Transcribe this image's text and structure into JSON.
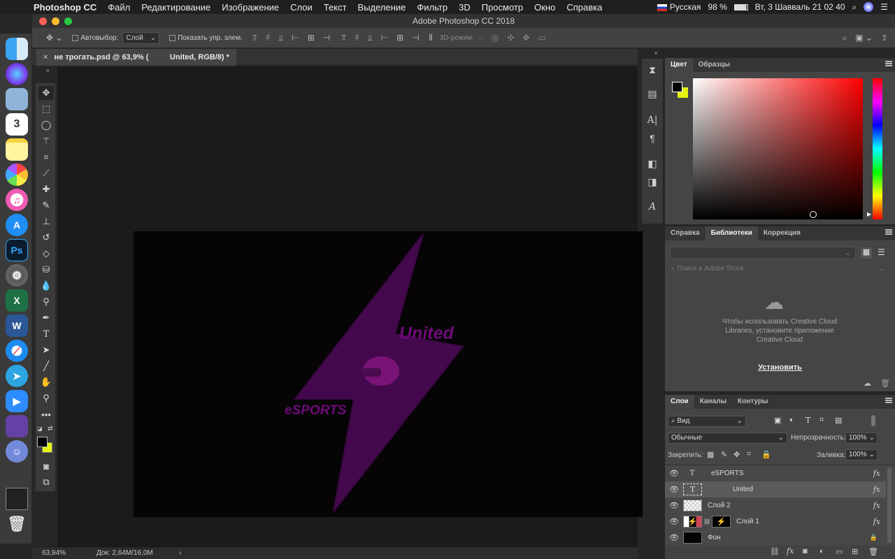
{
  "menubar": {
    "app_name": "Photoshop CC",
    "items": [
      "Файл",
      "Редактирование",
      "Изображение",
      "Слои",
      "Текст",
      "Выделение",
      "Фильтр",
      "3D",
      "Просмотр",
      "Окно",
      "Справка"
    ],
    "input_source": "Русская",
    "battery": "98 %",
    "clock": "Вт, 3 Шавваль  21 02 40"
  },
  "window": {
    "title": "Adobe Photoshop CC 2018"
  },
  "options_bar": {
    "autoselect_label": "Автовыбор:",
    "autoselect_value": "Слой",
    "show_transform_label": "Показать упр. элем.",
    "mode_3d_label": "3D-режим:"
  },
  "document": {
    "tab_title": "не трогать.psd @ 63,9% (          United, RGB/8) *"
  },
  "status_bar": {
    "zoom": "63,94%",
    "doc_size": "Док: 2,64M/16,0M"
  },
  "artwork": {
    "united_text": "United",
    "esports_text": "eSPORTS",
    "bolt_color": "#44094d",
    "text_color": "#6e0a78"
  },
  "color_panel": {
    "tabs": [
      "Цвет",
      "Образцы"
    ],
    "foreground": "#000000",
    "background": "#e4f312"
  },
  "libraries_panel": {
    "tabs": [
      "Справка",
      "Библиотеки",
      "Коррекция"
    ],
    "search_placeholder": "Поиск в Adobe Stock",
    "message": "Чтобы использовать Creative Cloud Libraries, установите приложение Creative Cloud",
    "install_link": "Установить"
  },
  "layers_panel": {
    "tabs": [
      "Слои",
      "Каналы",
      "Контуры"
    ],
    "filter_label": "Вид",
    "blend_mode": "Обычные",
    "opacity_label": "Непрозрачность:",
    "opacity_value": "100%",
    "lock_label": "Закрепить:",
    "fill_label": "Заливка:",
    "fill_value": "100%",
    "layers": [
      {
        "name": "eSPORTS",
        "type": "text",
        "fx": "fx"
      },
      {
        "name": "United",
        "type": "text",
        "fx": "fx",
        "selected": true
      },
      {
        "name": "Слой 2",
        "type": "raster",
        "fx": "fx"
      },
      {
        "name": "Слой 1",
        "type": "raster",
        "fx": "fx"
      },
      {
        "name": "Фон",
        "type": "background",
        "fx": ""
      }
    ]
  }
}
